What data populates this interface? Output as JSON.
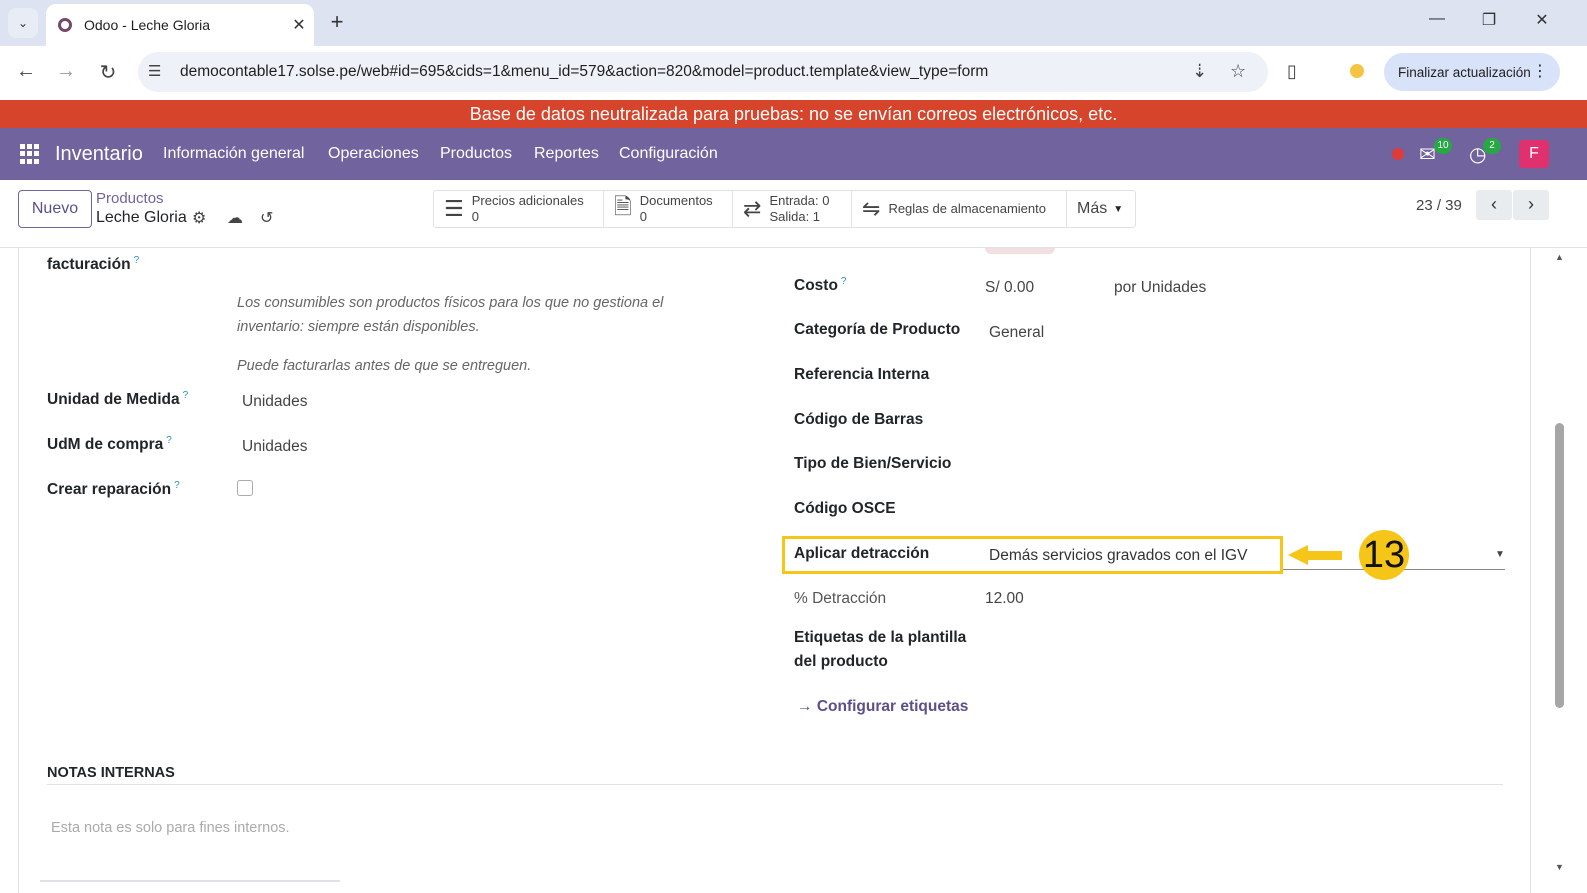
{
  "browser": {
    "tab_title": "Odoo - Leche Gloria",
    "url": "democontable17.solse.pe/web#id=695&cids=1&menu_id=579&action=820&model=product.template&view_type=form",
    "update_button": "Finalizar actualización"
  },
  "banner": "Base de datos neutralizada para pruebas: no se envían correos electrónicos, etc.",
  "topnav": {
    "brand": "Inventario",
    "menu": [
      "Información general",
      "Operaciones",
      "Productos",
      "Reportes",
      "Configuración"
    ],
    "messages_badge": "10",
    "activities_badge": "2",
    "avatar_letter": "F"
  },
  "controlpanel": {
    "new_button": "Nuevo",
    "breadcrumb_parent": "Productos",
    "breadcrumb_current": "Leche Gloria",
    "smart_buttons": [
      {
        "line1": "Precios adicionales",
        "line2": "0"
      },
      {
        "line1": "Documentos",
        "line2": "0"
      },
      {
        "line1": "Entrada: 0",
        "line2": "Salida: 1"
      },
      {
        "line1": "Reglas de almacenamiento",
        "line2": ""
      }
    ],
    "more_button": "Más",
    "pager": "23 / 39"
  },
  "form": {
    "left": {
      "facturacion_label": "facturación",
      "hint1": "Los consumibles son productos físicos para los que no gestiona el inventario: siempre están disponibles.",
      "hint2": "Puede facturarlas antes de que se entreguen.",
      "uom_label": "Unidad de Medida",
      "uom_value": "Unidades",
      "uom_po_label": "UdM de compra",
      "uom_po_value": "Unidades",
      "repair_label": "Crear reparación"
    },
    "right": {
      "cost_label": "Costo",
      "cost_value": "S/ 0.00",
      "cost_unit": "por Unidades",
      "category_label": "Categoría de Producto",
      "category_value": "General",
      "ref_label": "Referencia Interna",
      "barcode_label": "Código de Barras",
      "tipo_label": "Tipo de Bien/Servicio",
      "osce_label": "Código OSCE",
      "detraccion_label": "Aplicar detracción",
      "detraccion_value": "Demás servicios gravados con el IGV",
      "pct_label": "% Detracción",
      "pct_value": "12.00",
      "tags_label_1": "Etiquetas de la plantilla",
      "tags_label_2": "del producto",
      "config_tags": "Configurar etiquetas"
    },
    "notes_title": "NOTAS INTERNAS",
    "notes_placeholder": "Esta nota es solo para fines internos."
  },
  "annotation": {
    "step": "13",
    "color": "#f5c518"
  }
}
